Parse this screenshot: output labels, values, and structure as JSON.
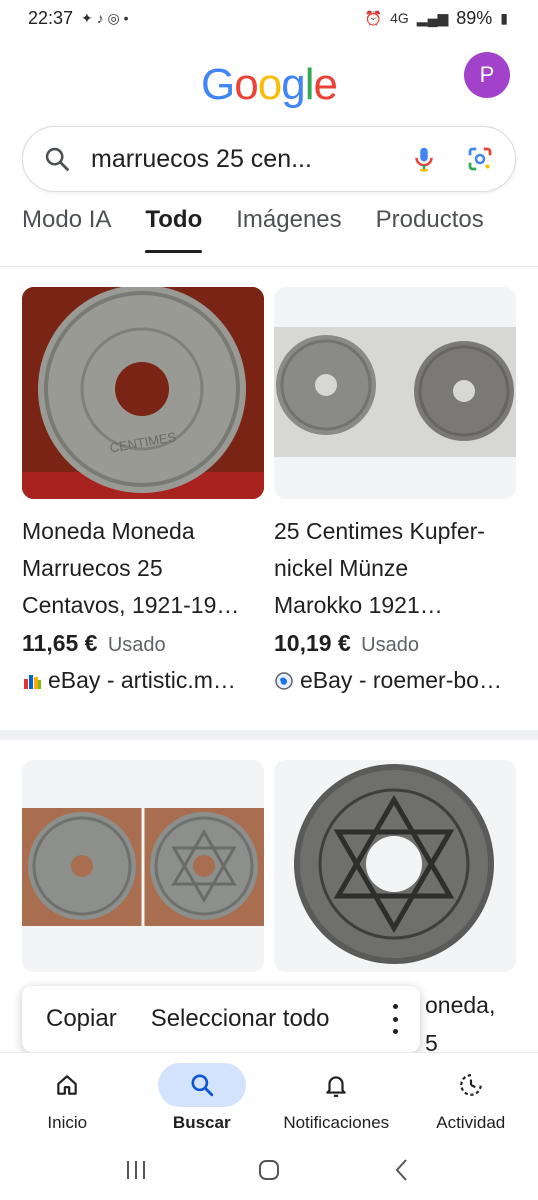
{
  "status_bar": {
    "time": "22:37",
    "network": "4G",
    "battery": "89%"
  },
  "header": {
    "logo_letters": [
      "G",
      "o",
      "o",
      "g",
      "l",
      "e"
    ],
    "logo_colors": [
      "#4285F4",
      "#EA4335",
      "#FBBC05",
      "#4285F4",
      "#34A853",
      "#EA4335"
    ],
    "avatar_letter": "P"
  },
  "search": {
    "query": "marruecos 25  cen..."
  },
  "tabs": [
    {
      "label": "Modo IA"
    },
    {
      "label": "Todo"
    },
    {
      "label": "Imágenes"
    },
    {
      "label": "Productos"
    }
  ],
  "products": [
    {
      "title_line1": "Moneda Moneda",
      "title_line2": "Marruecos 25",
      "title_line3": "Centavos, 1921-19…",
      "price": "11,65 €",
      "condition": "Usado",
      "seller": "eBay - artistic.m…"
    },
    {
      "title_line1": "25 Centimes Kupfer-",
      "title_line2": "nickel Münze",
      "title_line3": "Marokko 1921…",
      "price": "10,19 €",
      "condition": "Usado",
      "seller": "eBay - roemer-bo…"
    }
  ],
  "partial_texts": {
    "right_line1": "oneda,",
    "right_line2": "5"
  },
  "context_menu": {
    "copy": "Copiar",
    "select_all": "Seleccionar todo"
  },
  "bottom_nav": [
    {
      "label": "Inicio",
      "icon": "home-icon"
    },
    {
      "label": "Buscar",
      "icon": "search-icon"
    },
    {
      "label": "Notificaciones",
      "icon": "bell-icon"
    },
    {
      "label": "Actividad",
      "icon": "activity-icon"
    }
  ],
  "colors": {
    "accent": "#1a73e8",
    "active_nav_pill": "#d3e3fd",
    "avatar": "#a241c9"
  }
}
